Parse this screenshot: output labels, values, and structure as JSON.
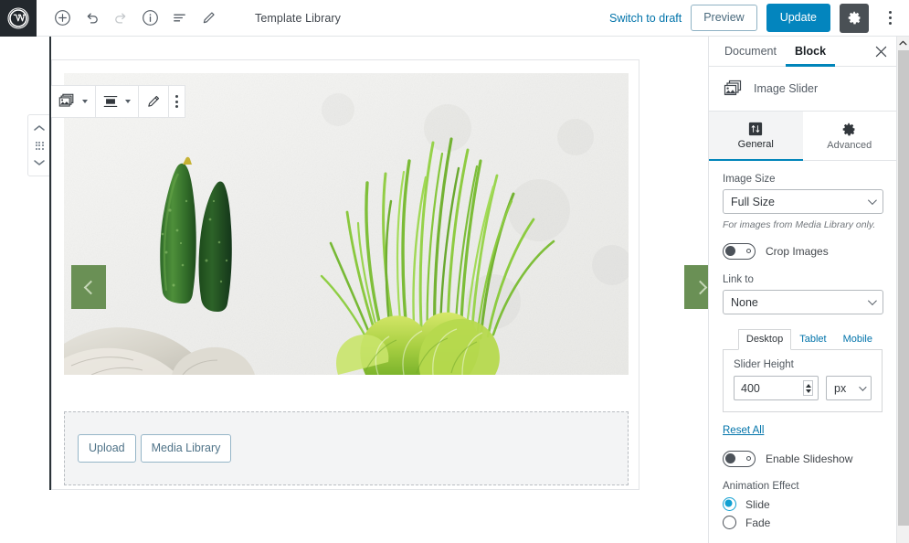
{
  "topbar": {
    "logo_icon": "wordpress-logo-icon",
    "tools": [
      {
        "name": "add-block-button",
        "icon": "plus-circle-icon"
      },
      {
        "name": "undo-button",
        "icon": "undo-arrow-icon"
      },
      {
        "name": "redo-button",
        "icon": "redo-arrow-icon"
      },
      {
        "name": "content-info-button",
        "icon": "info-circle-icon"
      },
      {
        "name": "block-navigation-button",
        "icon": "list-view-icon"
      },
      {
        "name": "edit-mode-button",
        "icon": "pencil-icon"
      }
    ],
    "document_title": "Template Library",
    "switch_to_draft": "Switch to draft",
    "preview": "Preview",
    "update": "Update",
    "settings_icon": "gear-icon",
    "more_menu_icon": "kebab-menu-icon",
    "update_color": "#0385be",
    "preview_border_color": "#8fb2c4",
    "link_color": "#0073aa"
  },
  "block_toolbar": {
    "items": [
      {
        "name": "change-block-type-button",
        "icon": "image-slider-block-icon",
        "has_caret": true
      },
      {
        "name": "align-button",
        "icon": "align-center-icon",
        "has_caret": true
      },
      {
        "name": "edit-image-button",
        "icon": "pencil-icon",
        "has_caret": false
      },
      {
        "name": "more-options-button",
        "icon": "kebab-menu-icon",
        "has_caret": false
      }
    ]
  },
  "mover": {
    "move_up_icon": "chevron-up-icon",
    "drag_handle_icon": "drag-dots-icon",
    "move_down_icon": "chevron-down-icon"
  },
  "slider": {
    "prev_icon": "chevron-left-icon",
    "next_icon": "chevron-right-icon",
    "arrow_color": "#6a9055",
    "arrow_chevron_color": "#c6d8b8",
    "image_alt": "Fresh cucumbers, chives and lettuce on a white textured surface with linen cloth"
  },
  "uploader": {
    "upload_label": "Upload",
    "media_library_label": "Media Library",
    "button_border_color": "#95b5c7",
    "button_text_color": "#4e7287"
  },
  "sidebar": {
    "tabs": [
      {
        "label": "Document",
        "active": false
      },
      {
        "label": "Block",
        "active": true
      }
    ],
    "close_icon": "close-icon",
    "block": {
      "icon": "image-slider-block-icon",
      "name": "Image Slider"
    },
    "settings_tabs": [
      {
        "label": "General",
        "icon": "sliders-icon",
        "active": true
      },
      {
        "label": "Advanced",
        "icon": "gear-icon",
        "active": false
      }
    ],
    "fields": {
      "image_size_label": "Image Size",
      "image_size_value": "Full Size",
      "image_size_helper": "For images from Media Library only.",
      "crop_images_label": "Crop Images",
      "crop_images_enabled": false,
      "link_to_label": "Link to",
      "link_to_value": "None",
      "device_tabs": [
        {
          "label": "Desktop",
          "active": true
        },
        {
          "label": "Tablet",
          "active": false
        },
        {
          "label": "Mobile",
          "active": false
        }
      ],
      "slider_height_label": "Slider Height",
      "slider_height_value": "400",
      "slider_height_unit": "px",
      "reset_all_label": "Reset All",
      "enable_slideshow_label": "Enable Slideshow",
      "enable_slideshow_enabled": false,
      "animation_effect_label": "Animation Effect",
      "animation_options": [
        {
          "label": "Slide",
          "selected": true
        },
        {
          "label": "Fade",
          "selected": false
        }
      ]
    },
    "accent_color": "#0085ba",
    "radio_accent": "#11a0d2"
  },
  "scrollbar": {
    "up_arrow_icon": "chevron-up-icon"
  }
}
